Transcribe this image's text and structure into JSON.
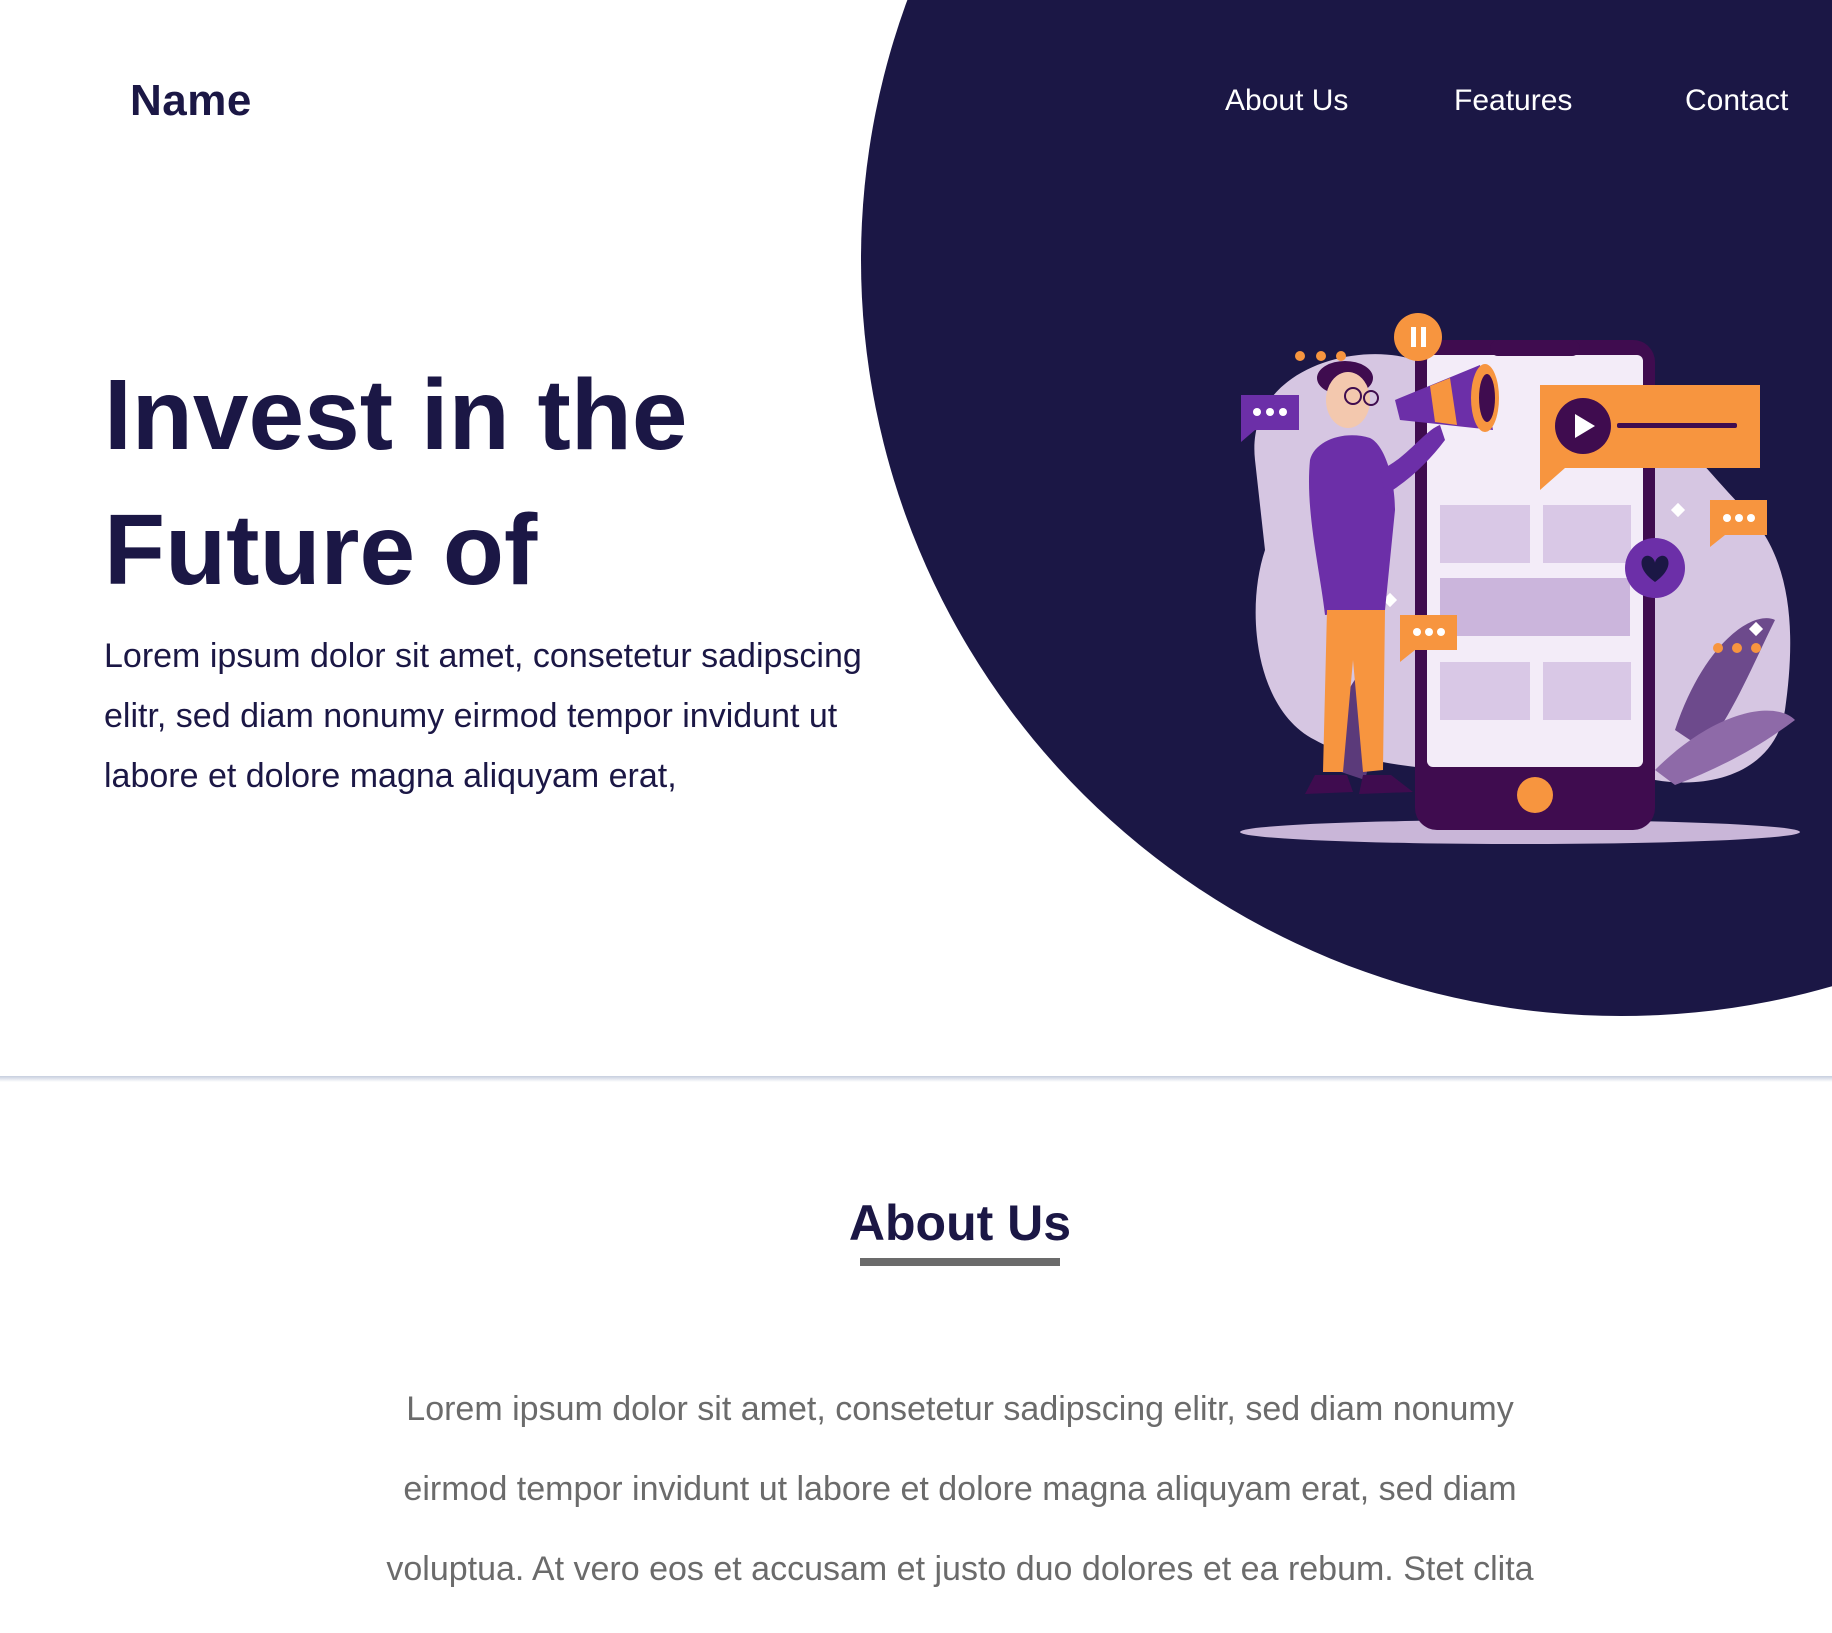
{
  "brand": {
    "name": "Name"
  },
  "nav": {
    "items": [
      {
        "label": "About Us"
      },
      {
        "label": "Features"
      },
      {
        "label": "Contact"
      }
    ]
  },
  "hero": {
    "title": "Invest in the Future of",
    "text": "Lorem ipsum dolor sit amet, consetetur sadipscing elitr, sed diam nonumy eirmod tempor invidunt ut labore et dolore magna aliquyam erat,"
  },
  "about": {
    "title": "About Us",
    "text": "Lorem ipsum dolor sit amet, consetetur sadipscing elitr, sed diam nonumy eirmod tempor invidunt ut labore et dolore magna aliquyam erat, sed diam voluptua. At vero eos et accusam et justo duo dolores et ea rebum. Stet clita kasd gubergren, no sea takimata sanctus est"
  },
  "colors": {
    "primary": "#1b1745",
    "accent_orange": "#f7953f",
    "accent_purple": "#6c2fa8",
    "muted_text": "#6b6b6b"
  },
  "illustration": {
    "icon": "marketing-megaphone-illustration"
  }
}
